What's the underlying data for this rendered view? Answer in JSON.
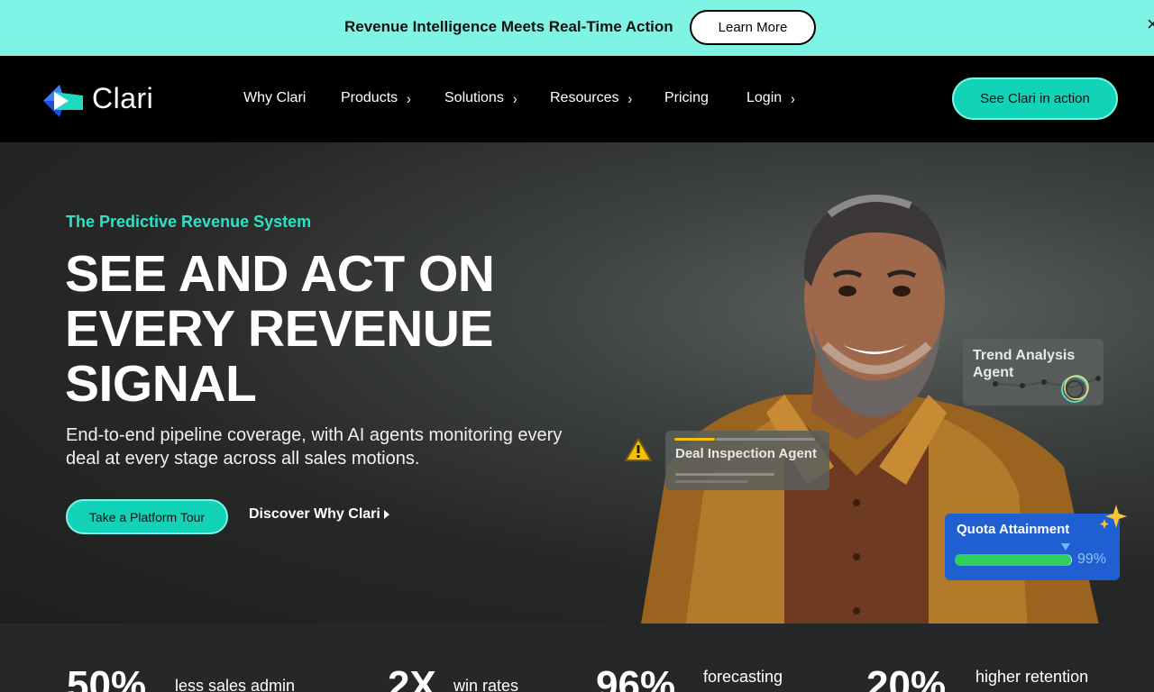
{
  "announcement": {
    "text": "Revenue Intelligence Meets Real-Time Action",
    "button": "Learn More",
    "close": "×"
  },
  "nav": {
    "logo": "Clari",
    "items": [
      {
        "label": "Why Clari",
        "has_chevron": false
      },
      {
        "label": "Products",
        "has_chevron": true
      },
      {
        "label": "Solutions",
        "has_chevron": true
      },
      {
        "label": "Resources",
        "has_chevron": true
      },
      {
        "label": "Pricing",
        "has_chevron": false
      },
      {
        "label": "Login",
        "has_chevron": true
      }
    ],
    "chevron": "›",
    "cta": "See Clari in action"
  },
  "hero": {
    "eyebrow": "The Predictive Revenue System",
    "headline_lines": [
      "SEE AND ACT ON",
      "EVERY REVENUE",
      "SIGNAL"
    ],
    "subhead": "End-to-end pipeline coverage, with AI agents monitoring every deal at every stage across all sales motions.",
    "primary_button": "Take a Platform Tour",
    "secondary_link": "Discover Why Clari"
  },
  "cards": {
    "trend": {
      "title": "Trend Analysis Agent"
    },
    "deal": {
      "title": "Deal Inspection Agent"
    },
    "quota": {
      "title": "Quota Attainment",
      "percent_label": "99%",
      "progress": 0.99
    }
  },
  "stats": [
    {
      "value": "50%",
      "label": "less sales admin"
    },
    {
      "value": "2X",
      "label": "win rates"
    },
    {
      "value": "96%",
      "label": "forecasting"
    },
    {
      "value": "20%",
      "label": "higher retention"
    }
  ],
  "colors": {
    "announce_bg": "#7ff3e4",
    "accent": "#12d3b8",
    "eyebrow": "#2ee0c4",
    "quota_card": "#1f5fd1",
    "quota_fill": "#2fcf5d",
    "warning": "#f2c200"
  }
}
